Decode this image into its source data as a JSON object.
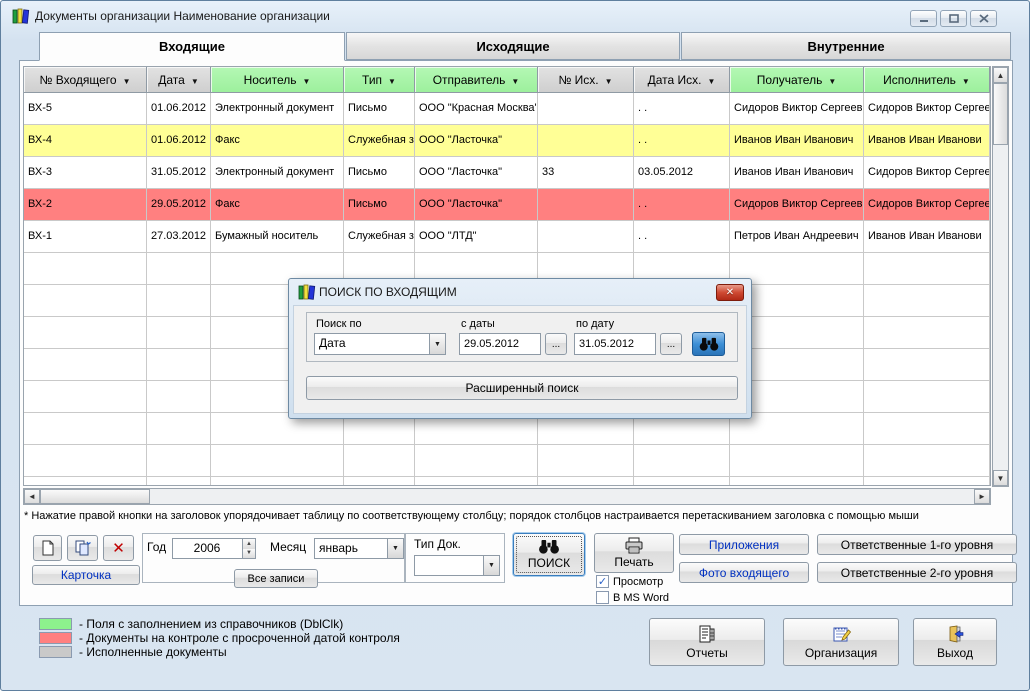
{
  "window": {
    "title": "Документы организации Наименование организации"
  },
  "tabs": [
    {
      "label": "Входящие",
      "active": true
    },
    {
      "label": "Исходящие",
      "active": false
    },
    {
      "label": "Внутренние",
      "active": false
    }
  ],
  "table": {
    "columns": [
      {
        "label": "№ Входящего",
        "style": "gray"
      },
      {
        "label": "Дата",
        "style": "gray"
      },
      {
        "label": "Носитель",
        "style": "green"
      },
      {
        "label": "Тип",
        "style": "green"
      },
      {
        "label": "Отправитель",
        "style": "green"
      },
      {
        "label": "№ Исх.",
        "style": "gray"
      },
      {
        "label": "Дата Исх.",
        "style": "gray"
      },
      {
        "label": "Получатель",
        "style": "green"
      },
      {
        "label": "Исполнитель",
        "style": "green"
      }
    ],
    "rows": [
      {
        "bg": "white",
        "cells": [
          "ВХ-5",
          "01.06.2012",
          "Электронный документ",
          "Письмо",
          "ООО \"Красная Москва\"",
          "",
          ". .",
          "Сидоров Виктор Сергееви",
          "Сидоров Виктор Сергееви"
        ]
      },
      {
        "bg": "yellow",
        "cells": [
          "ВХ-4",
          "01.06.2012",
          "Факс",
          "Служебная зап",
          "ООО \"Ласточка\"",
          "",
          ". .",
          "Иванов Иван Иванович",
          "Иванов Иван Иванови"
        ]
      },
      {
        "bg": "white",
        "cells": [
          "ВХ-3",
          "31.05.2012",
          "Электронный документ",
          "Письмо",
          "ООО \"Ласточка\"",
          "33",
          "03.05.2012",
          "Иванов Иван Иванович",
          "Сидоров Виктор Сергееви"
        ]
      },
      {
        "bg": "red",
        "cells": [
          "ВХ-2",
          "29.05.2012",
          "Факс",
          "Письмо",
          "ООО \"Ласточка\"",
          "",
          ". .",
          "Сидоров Виктор Сергееви",
          "Сидоров Виктор Сергееви"
        ]
      },
      {
        "bg": "white",
        "cells": [
          "ВХ-1",
          "27.03.2012",
          "Бумажный носитель",
          "Служебная зап",
          "ООО \"ЛТД\"",
          "",
          ". .",
          "Петров Иван Андреевич",
          "Иванов Иван Иванови"
        ]
      }
    ],
    "empty_row_count": 8
  },
  "footnote": "* Нажатие правой кнопки на заголовок упорядочивает таблицу по соответствующему  столбцу;  порядок столбцов настраивается перетаскиванием заголовка с помощью мыши",
  "toolbar": {
    "card_button": "Карточка",
    "delete_glyph": "✕",
    "year_label": "Год",
    "year_value": "2006",
    "month_label": "Месяц",
    "month_value": "январь",
    "all_records_button": "Все записи",
    "doc_type_label": "Тип Док.",
    "doc_type_value": "",
    "search_button": "ПОИСК",
    "print_button": "Печать",
    "preview_checkbox": {
      "label": "Просмотр",
      "checked": true,
      "mark": "✓"
    },
    "msword_checkbox": {
      "label": "В MS Word",
      "checked": false,
      "mark": ""
    },
    "attachments_button": "Приложения",
    "photo_button": "Фото входящего",
    "responsible1_button": "Ответственные 1-го уровня",
    "responsible2_button": "Ответственные 2-го уровня"
  },
  "dialog": {
    "title": "ПОИСК ПО ВХОДЯЩИМ",
    "close_glyph": "✕",
    "search_by_label": "Поиск по",
    "search_by_value": "Дата",
    "date_from_label": "с даты",
    "date_from_value": "29.05.2012",
    "date_to_label": "по дату",
    "date_to_value": "31.05.2012",
    "browse_button": "...",
    "advanced_search_button": "Расширенный поиск"
  },
  "legend": [
    {
      "label": "- Поля с заполнением из справочников (DblClk)",
      "color": "#8df28d"
    },
    {
      "label": "- Документы на контроле с просроченной датой контроля",
      "color": "#ff8080"
    },
    {
      "label": "- Исполненные документы",
      "color": "#c9c9c9"
    }
  ],
  "footer_buttons": [
    {
      "label": "Отчеты"
    },
    {
      "label": "Организация"
    },
    {
      "label": "Выход"
    }
  ],
  "colors": {
    "row_yellow": "#ffff96",
    "row_overdue": "#ff8080",
    "header_green": "#a7f3a7",
    "header_gray": "#d6d6d6",
    "link_blue": "#0030c0",
    "find_button_blue": "#3d8fd6"
  }
}
